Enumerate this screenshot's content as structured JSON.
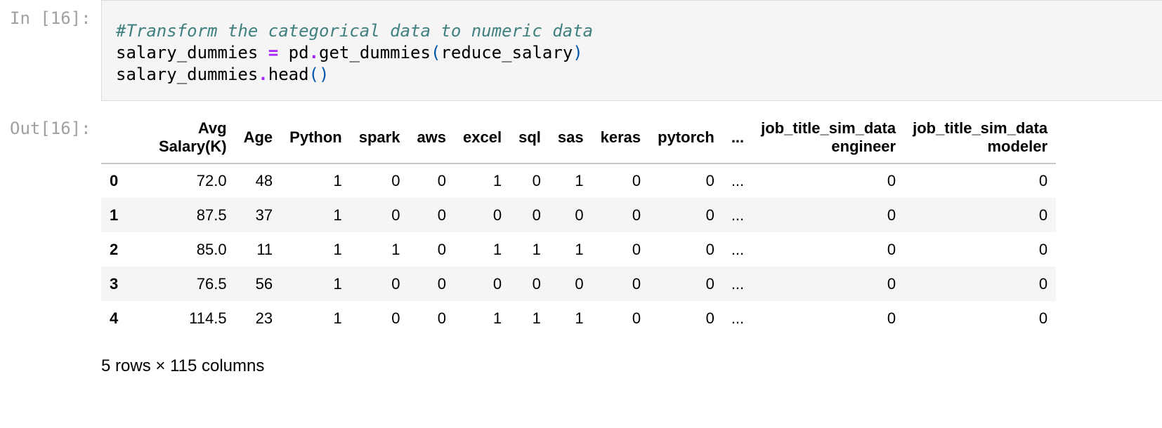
{
  "input_prompt": "In [16]:",
  "output_prompt": "Out[16]:",
  "code": {
    "line1_comment": "#Transform the categorical data to numeric data",
    "line2": {
      "var": "salary_dummies",
      "op": "=",
      "obj": "pd",
      "dot": ".",
      "func": "get_dummies",
      "lparen": "(",
      "arg": "reduce_salary",
      "rparen": ")"
    },
    "line3": {
      "obj": "salary_dummies",
      "dot": ".",
      "func": "head",
      "parens": "()"
    }
  },
  "table": {
    "columns": [
      [
        "Avg",
        "Salary(K)"
      ],
      [
        "",
        "Age"
      ],
      [
        "",
        "Python"
      ],
      [
        "",
        "spark"
      ],
      [
        "",
        "aws"
      ],
      [
        "",
        "excel"
      ],
      [
        "",
        "sql"
      ],
      [
        "",
        "sas"
      ],
      [
        "",
        "keras"
      ],
      [
        "",
        "pytorch"
      ],
      [
        "",
        "..."
      ],
      [
        "job_title_sim_data",
        "engineer"
      ],
      [
        "job_title_sim_data",
        "modeler"
      ]
    ],
    "rows": [
      {
        "index": "0",
        "values": [
          "72.0",
          "48",
          "1",
          "0",
          "0",
          "1",
          "0",
          "1",
          "0",
          "0",
          "...",
          "0",
          "0"
        ]
      },
      {
        "index": "1",
        "values": [
          "87.5",
          "37",
          "1",
          "0",
          "0",
          "0",
          "0",
          "0",
          "0",
          "0",
          "...",
          "0",
          "0"
        ]
      },
      {
        "index": "2",
        "values": [
          "85.0",
          "11",
          "1",
          "1",
          "0",
          "1",
          "1",
          "1",
          "0",
          "0",
          "...",
          "0",
          "0"
        ]
      },
      {
        "index": "3",
        "values": [
          "76.5",
          "56",
          "1",
          "0",
          "0",
          "0",
          "0",
          "0",
          "0",
          "0",
          "...",
          "0",
          "0"
        ]
      },
      {
        "index": "4",
        "values": [
          "114.5",
          "23",
          "1",
          "0",
          "0",
          "1",
          "1",
          "1",
          "0",
          "0",
          "...",
          "0",
          "0"
        ]
      }
    ]
  },
  "row_count_text": "5 rows × 115 columns"
}
